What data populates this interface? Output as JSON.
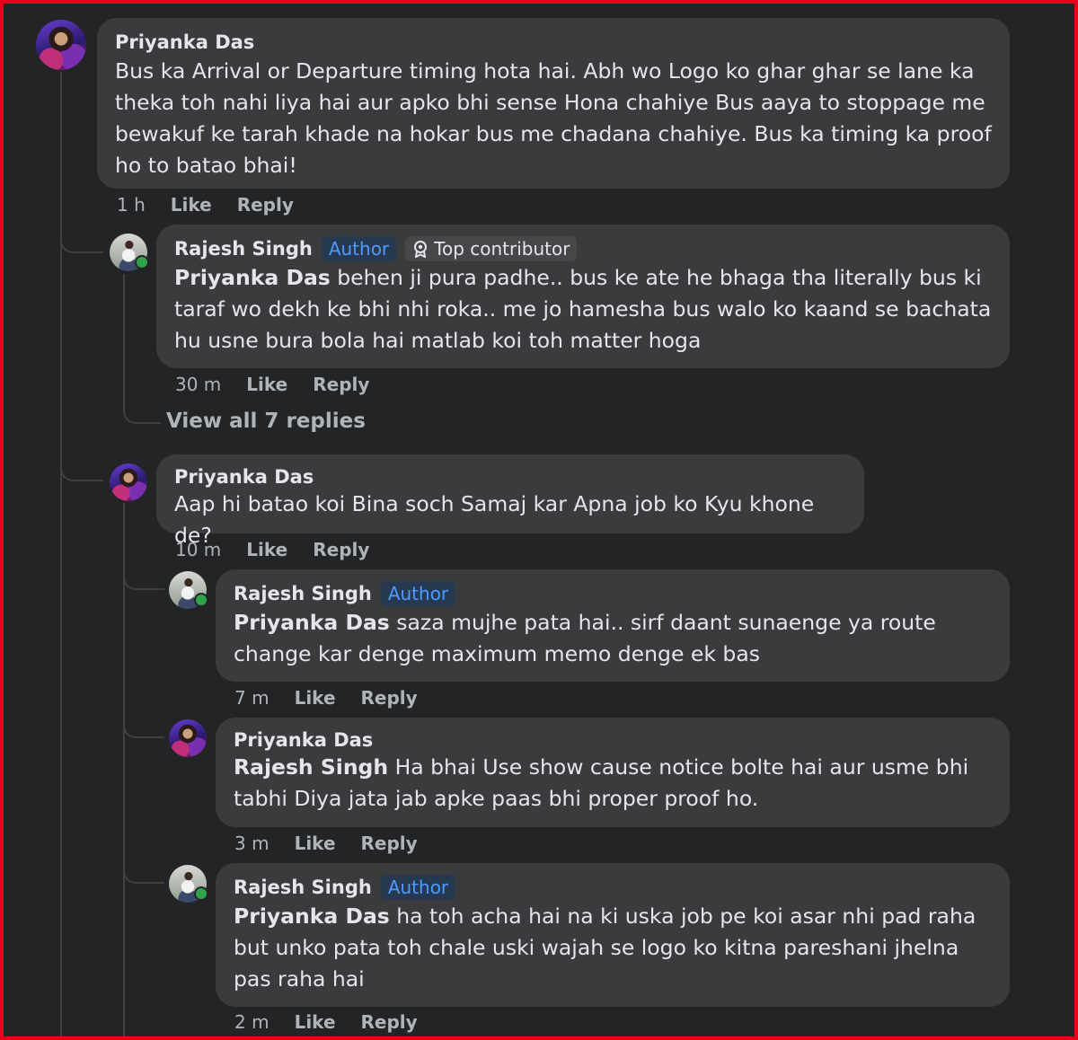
{
  "comments": [
    {
      "author": "Priyanka Das",
      "text": "Bus ka Arrival or Departure timing hota hai. Abh wo Logo ko ghar ghar se lane ka theka toh nahi liya hai aur apko bhi sense Hona chahiye Bus aaya to stoppage me bewakuf ke tarah khade na hokar bus me chadana chahiye. Bus ka timing ka proof ho to batao bhai!",
      "time": "1 h",
      "like": "Like",
      "reply": "Reply"
    },
    {
      "author": "Rajesh Singh",
      "badge": "Author",
      "badge2": "Top contributor",
      "mention": "Priyanka Das",
      "text": " behen ji pura padhe.. bus ke ate he bhaga tha literally bus ki taraf wo dekh ke bhi nhi roka.. me jo hamesha bus walo ko kaand se bachata hu usne bura bola hai matlab koi toh matter hoga",
      "time": "30 m",
      "like": "Like",
      "reply": "Reply"
    },
    {
      "author": "Priyanka Das",
      "text": "Aap hi batao koi Bina soch Samaj kar Apna job ko Kyu khone de?",
      "time": "10 m",
      "like": "Like",
      "reply": "Reply"
    },
    {
      "author": "Rajesh Singh",
      "badge": "Author",
      "mention": "Priyanka Das",
      "text": " saza mujhe pata hai.. sirf daant sunaenge ya route change kar denge maximum memo denge ek bas",
      "time": "7 m",
      "like": "Like",
      "reply": "Reply"
    },
    {
      "author": "Priyanka Das",
      "mention": "Rajesh Singh",
      "text": " Ha bhai Use show cause notice bolte hai aur usme bhi tabhi Diya jata jab apke paas bhi proper proof ho.",
      "time": "3 m",
      "like": "Like",
      "reply": "Reply"
    },
    {
      "author": "Rajesh Singh",
      "badge": "Author",
      "mention": "Priyanka Das",
      "text": " ha toh acha hai na ki uska job pe koi asar nhi pad raha but unko pata toh chale uski wajah se logo ko kitna pareshani jhelna pas raha hai",
      "time": "2 m",
      "like": "Like",
      "reply": "Reply"
    }
  ],
  "view_all_replies": "View all 7 replies",
  "icons": {
    "contributor": "top-contributor-icon"
  }
}
